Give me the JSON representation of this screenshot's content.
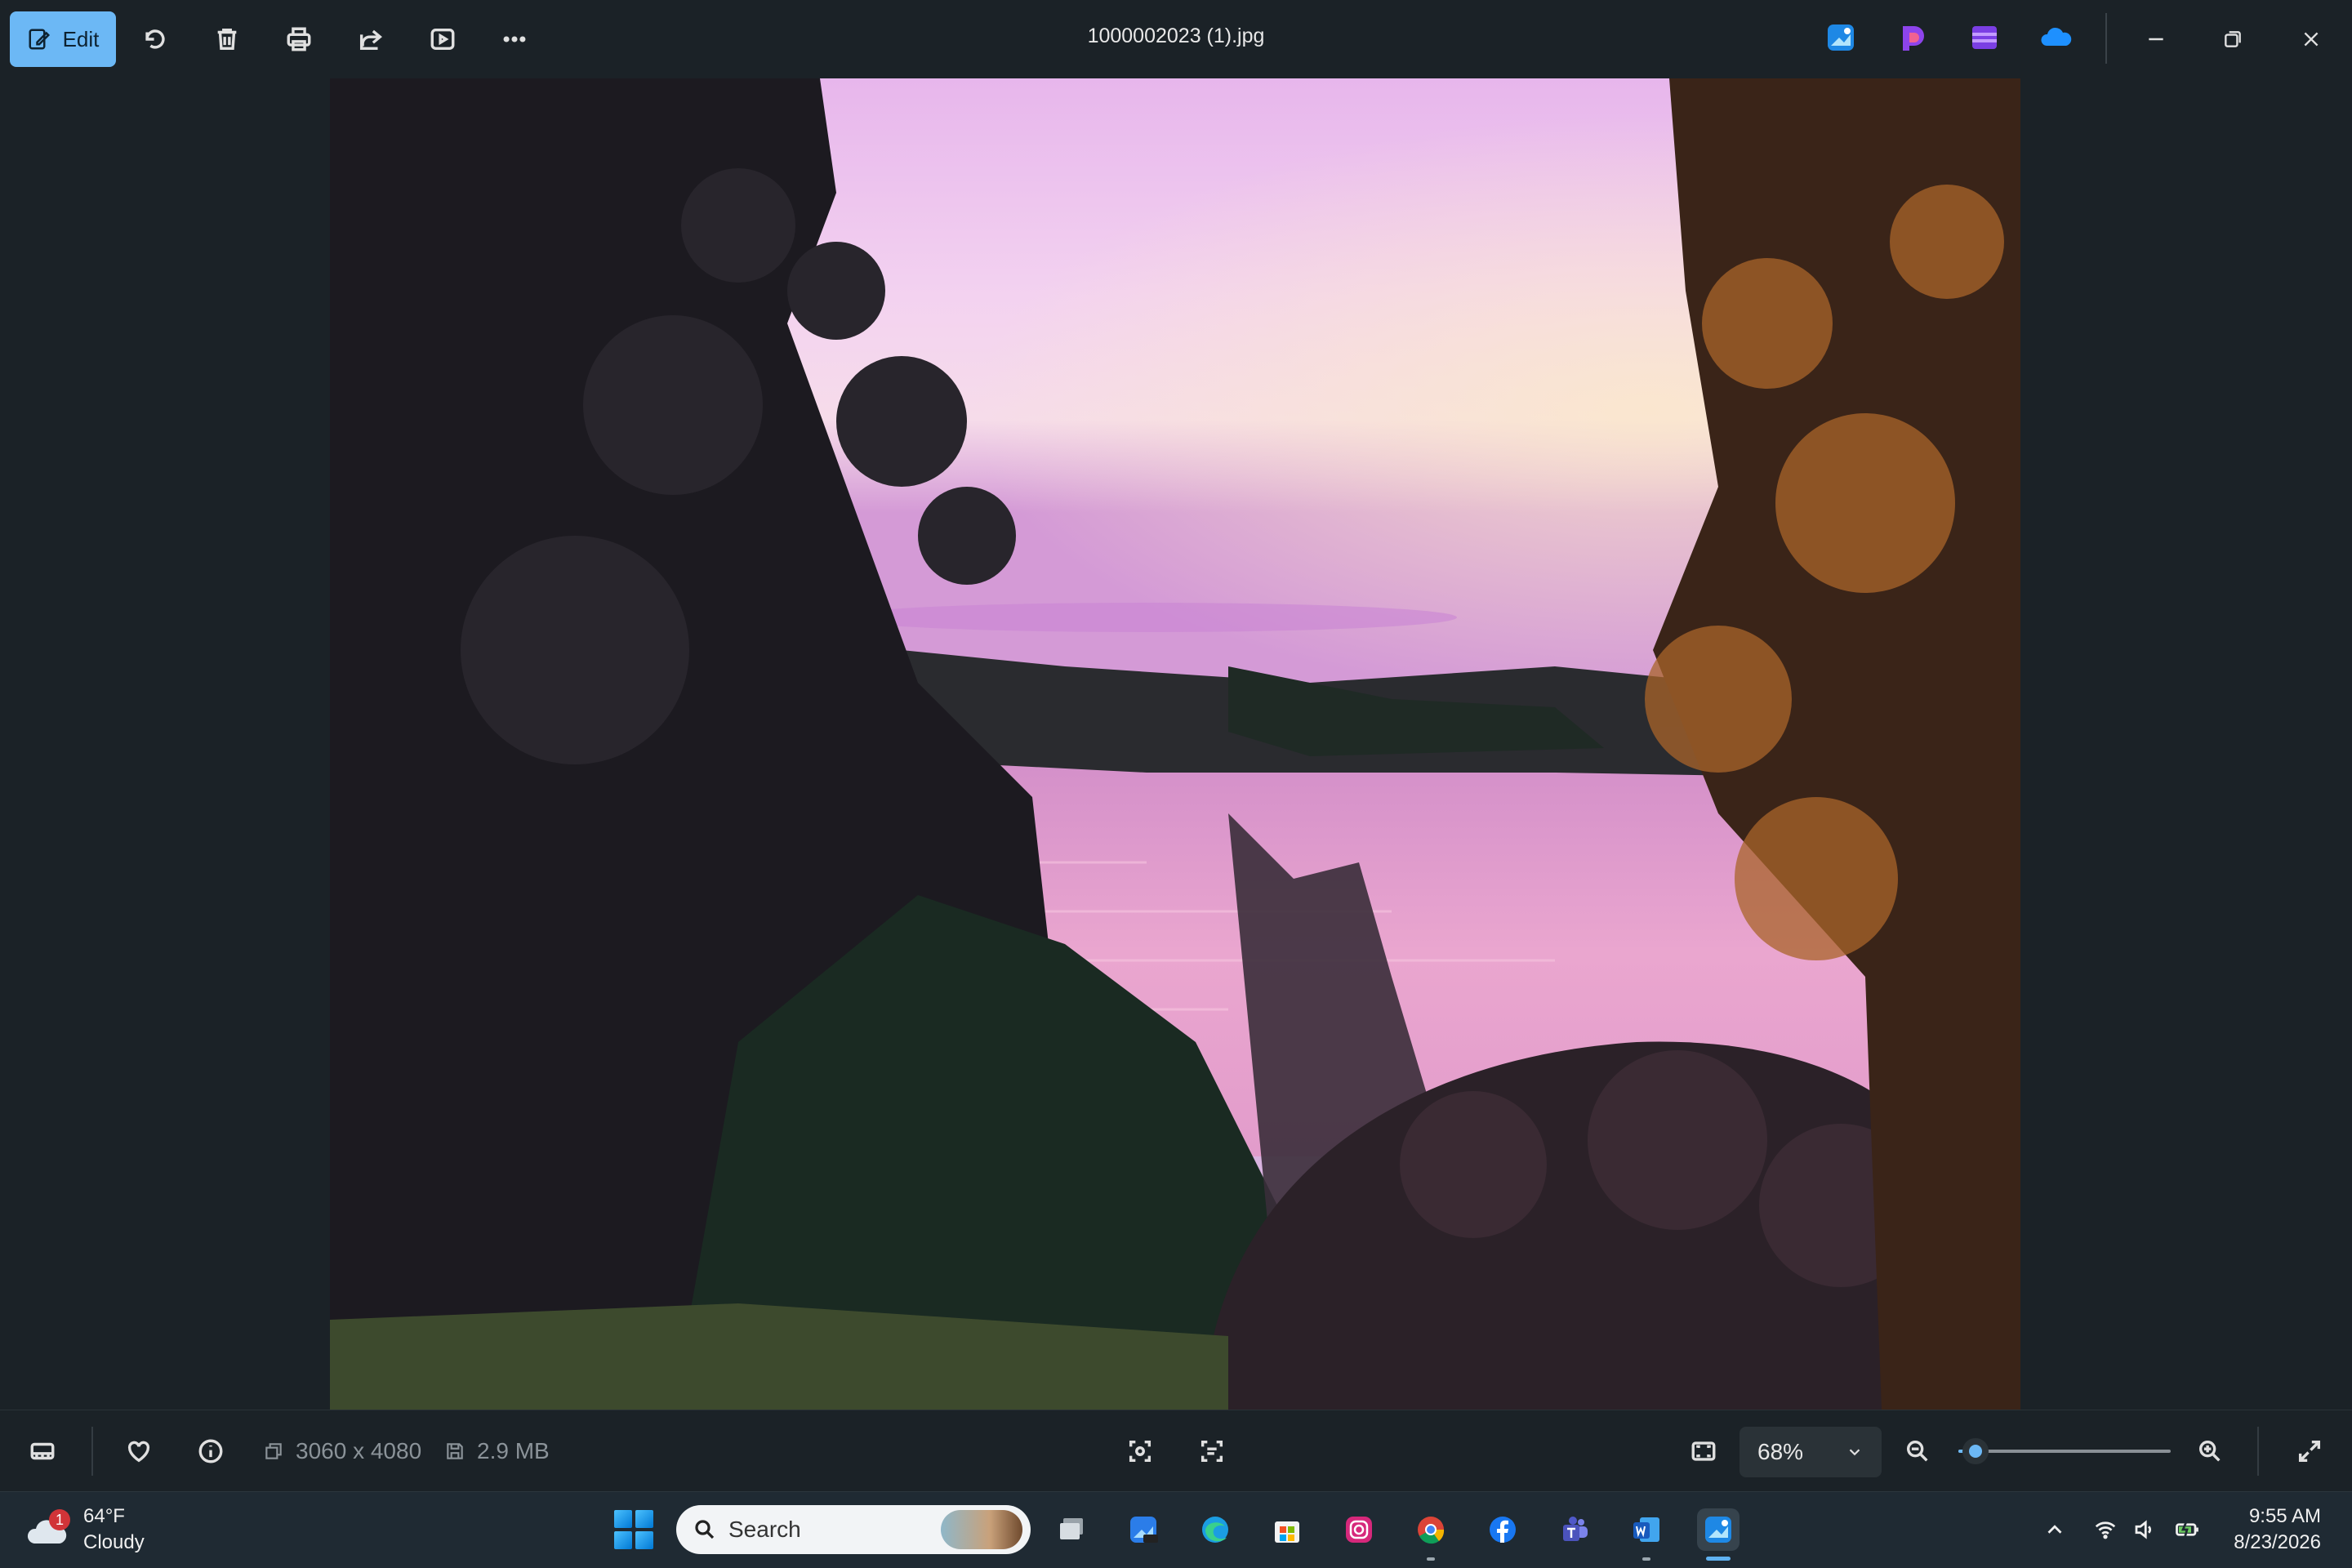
{
  "window": {
    "file_name": "1000002023 (1).jpg",
    "edit_label": "Edit"
  },
  "toolbar": {
    "icons": [
      "edit-icon",
      "rotate-icon",
      "delete-icon",
      "print-icon",
      "share-icon",
      "slideshow-icon",
      "more-icon"
    ],
    "app_shortcuts": [
      "photos-icon",
      "clipchamp-icon",
      "designer-icon",
      "onedrive-icon"
    ],
    "window_controls": [
      "minimize-icon",
      "restore-icon",
      "close-icon"
    ]
  },
  "info_bar": {
    "dimensions": "3060 x 4080",
    "file_size": "2.9 MB",
    "zoom_value": "68%",
    "zoom_level": 0.08
  },
  "taskbar": {
    "weather_badge": "1",
    "temperature": "64°F",
    "condition": "Cloudy",
    "search_placeholder": "Search",
    "time": "9:55 AM",
    "date": "8/23/2026"
  },
  "colors": {
    "accent": "#6cb8f5",
    "background": "#1b2227",
    "taskbar": "#1f2a33"
  }
}
